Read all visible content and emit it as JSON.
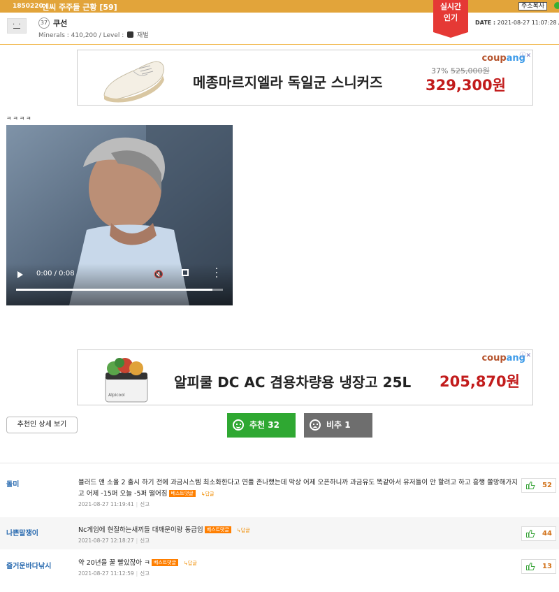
{
  "header": {
    "post_id": "1850220",
    "title": "엔씨 주주들 근황 [59]",
    "copy_button": "주소복사",
    "live_tag": [
      "실시간",
      "인기"
    ],
    "bg_color": "#e2a43a"
  },
  "author": {
    "level": "37",
    "name": "쿠선",
    "minerals_label": "Minerals : 410,200 / Level :",
    "level_name": "재벌",
    "date_label": "DATE :",
    "date": "2021-08-27 11:07:28 /"
  },
  "ads": [
    {
      "brand": "coupang",
      "title": "메종마르지엘라 독일군 스니커즈",
      "discount": "37%",
      "original_price": "525,000원",
      "price": "329,300원",
      "image_icon": "sneaker-image"
    },
    {
      "brand": "coupang",
      "title": "알피쿨 DC AC 겸용차량용 냉장고 25L",
      "price": "205,870원",
      "image_icon": "fridge-image"
    }
  ],
  "post": {
    "text": "ㅋㅋㅋㅋ",
    "video": {
      "time": "0:00 / 0:08",
      "progress": 0.95
    }
  },
  "recommend": {
    "detail_label": "추천인 상세 보기",
    "up_label": "추천 32",
    "down_label": "비추 1",
    "up_color": "#2fa832",
    "down_color": "#6e6e6e"
  },
  "comments": [
    {
      "name": "돌미",
      "text": "블러드 앤 소울 2 출시 하기 전에 과금시스템 최소화한다고 연플 존나했는데 막상 어제 오픈하니까 과금유도 똑같아서 유저들이 안 할려고 하고 흥행 쫄망해가지고 어제 -15퍼 오늘 -5퍼 떨어짐",
      "best": "베스트댓글",
      "reply": "↳답글",
      "date": "2021-08-27 11:19:41",
      "report": "신고",
      "likes": "52"
    },
    {
      "name": "나쁜말쟁이",
      "text": "Nc게임에 현질하는새끼들 대깨문이랑 동급임",
      "best": "베스트댓글",
      "reply": "↳답글",
      "date": "2021-08-27 12:18:27",
      "report": "신고",
      "likes": "44"
    },
    {
      "name": "즐거운바다낚시",
      "text": "약 20년을 꿀 빨았잖아 ㅋ",
      "best": "베스트댓글",
      "reply": "↳답글",
      "date": "2021-08-27 11:12:59",
      "report": "신고",
      "likes": "13"
    }
  ]
}
